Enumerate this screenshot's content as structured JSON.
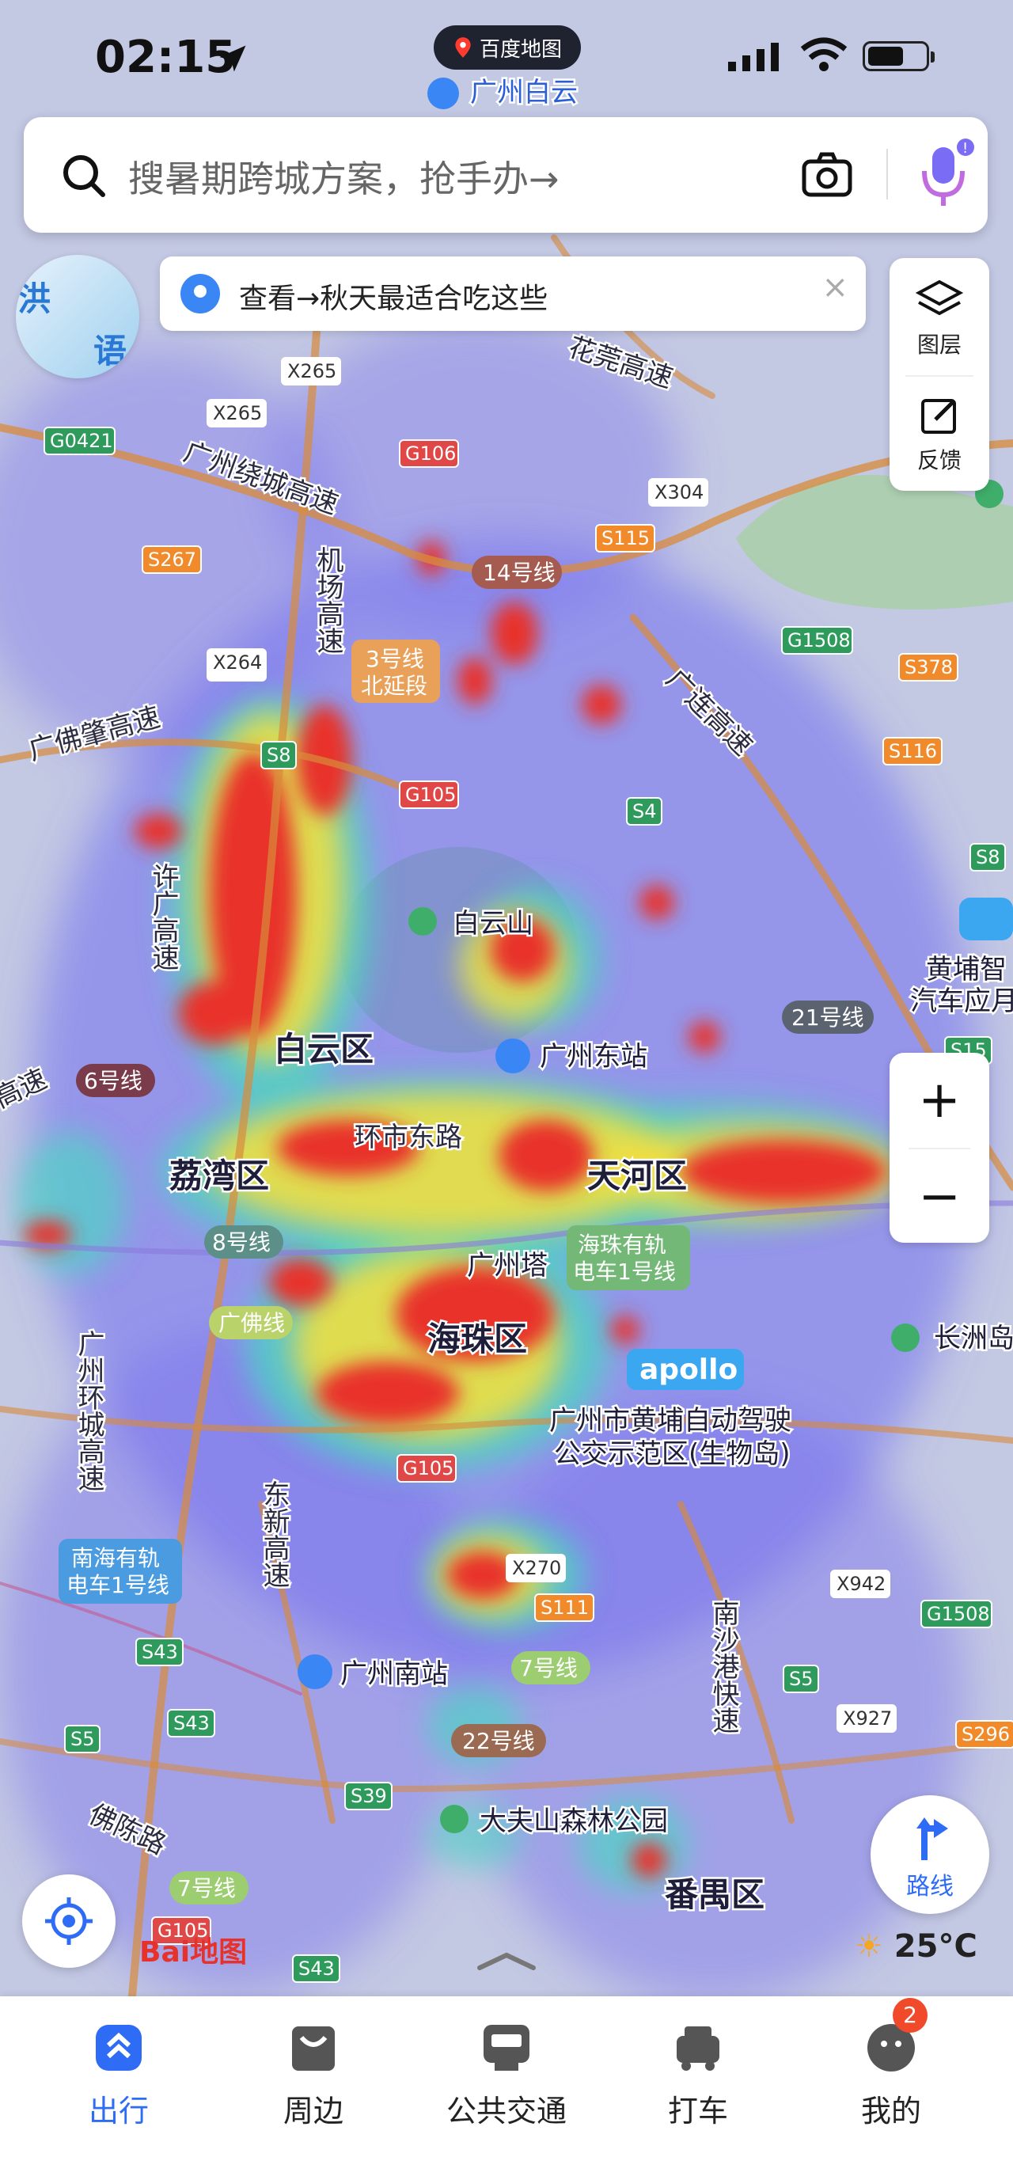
{
  "status_bar": {
    "time": "02:15",
    "app_name": "百度地图"
  },
  "search": {
    "placeholder": "搜暑期跨城方案，抢手办→"
  },
  "banner": {
    "text": "查看→秋天最适合吃这些"
  },
  "floating_badge": {
    "line1": "洪",
    "line2": "语"
  },
  "map_controls": {
    "layers_label": "图层",
    "feedback_label": "反馈",
    "zoom_in": "+",
    "zoom_out": "−",
    "route_label": "路线"
  },
  "weather": {
    "temp": "25°C"
  },
  "map": {
    "district_labels": [
      "白云区",
      "荔湾区",
      "天河区",
      "海珠区",
      "番禺区"
    ],
    "place_labels": [
      "白云山",
      "广州东站",
      "广州塔",
      "广州南站",
      "大夫山森林公园",
      "长洲岛",
      "广州白云",
      "黄埔智",
      "汽车应月",
      "广州市黄埔自动驾驶",
      "公交示范区(生物岛)"
    ],
    "road_labels": [
      "广州绕城高速",
      "机场高速",
      "广佛肇高速",
      "许广高速",
      "环市东路",
      "广州环城高速",
      "东新高速",
      "南沙港快速",
      "广连高速",
      "花莞高速",
      "佛陈路",
      "高速"
    ],
    "metro_labels": [
      "14号线",
      "3号线",
      "北延段",
      "21号线",
      "6号线",
      "8号线",
      "广佛线",
      "7号线",
      "22号线",
      "海珠有轨",
      "电车1号线",
      "南海有轨",
      "电车1号线"
    ],
    "shields": [
      "X265",
      "X265",
      "X264",
      "G0421",
      "G106",
      "S267",
      "S8",
      "G105",
      "X304",
      "S115",
      "G1508",
      "S378",
      "S116",
      "S4",
      "S8",
      "S15",
      "G105",
      "X270",
      "S111",
      "X942",
      "G1508",
      "S5",
      "X927",
      "S296",
      "S43",
      "S43",
      "S5",
      "S39",
      "G105",
      "S43",
      "X264"
    ],
    "apollo": "apollo",
    "baidu_logo": "Bai地图"
  },
  "tabs": [
    {
      "label": "出行",
      "active": true
    },
    {
      "label": "周边",
      "active": false
    },
    {
      "label": "公共交通",
      "active": false
    },
    {
      "label": "打车",
      "active": false
    },
    {
      "label": "我的",
      "active": false,
      "badge": "2"
    }
  ],
  "colors": {
    "accent": "#2f6cf5",
    "heat_high": "#e8332a",
    "heat_mid": "#ffd23a",
    "heat_low": "#5b5fe8"
  }
}
